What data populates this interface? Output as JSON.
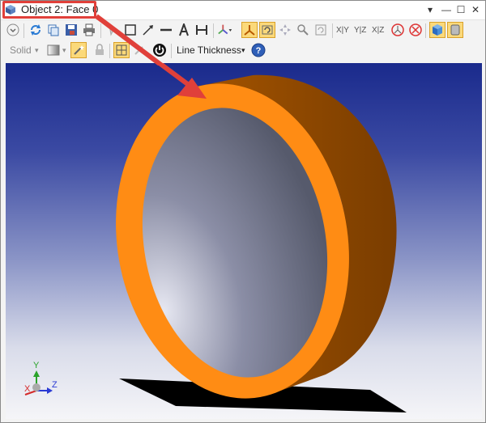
{
  "window": {
    "title": "Object 2: Face 0",
    "buttons": [
      "▾",
      "—",
      "☐",
      "✕"
    ]
  },
  "toolbar1": {
    "axis_labels": [
      "X|Y",
      "Y|Z",
      "X|Z"
    ]
  },
  "toolbar2": {
    "render_mode": "Solid",
    "line_thickness_label": "Line Thickness",
    "help_label": "?"
  },
  "viewport": {
    "background_top": "#1a2a8c",
    "background_bottom": "#f5f5f8",
    "ring_color": "#ff8c14",
    "side_color": "#8a4300",
    "face_color": "#5f6275",
    "triad_labels": [
      "X",
      "Y",
      "Z"
    ]
  },
  "annotation": {
    "arrow_color": "#e0403a"
  }
}
